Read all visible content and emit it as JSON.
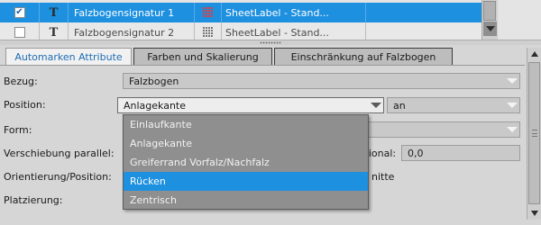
{
  "table": {
    "rows": [
      {
        "checked": true,
        "check_mark": "✔",
        "type_glyph": "T",
        "name": "Falzbogensignatur 1",
        "label": "SheetLabel - Stand..."
      },
      {
        "checked": false,
        "check_mark": "",
        "type_glyph": "T",
        "name": "Falzbogensignatur 2",
        "label": "SheetLabel - Stand..."
      }
    ]
  },
  "tabs": [
    {
      "label": "Automarken Attribute",
      "active": true
    },
    {
      "label": "Farben und Skalierung",
      "active": false
    },
    {
      "label": "Einschränkung auf Falzbogen",
      "active": false
    }
  ],
  "form": {
    "bezug": {
      "label": "Bezug:",
      "value": "Falzbogen"
    },
    "position": {
      "label": "Position:",
      "value": "Anlagekante",
      "secondary_value": "an"
    },
    "form": {
      "label": "Form:"
    },
    "verschiebung": {
      "label": "Verschiebung parallel:",
      "suffix_label": "rtional:",
      "value": "0,0"
    },
    "orientierung": {
      "label": "Orientierung/Position:",
      "suffix_label": "nitte"
    },
    "platzierung": {
      "label": "Platzierung:"
    }
  },
  "dropdown": {
    "options": [
      "Einlaufkante",
      "Anlagekante",
      "Greiferrand Vorfalz/Nachfalz",
      "Rücken",
      "Zentrisch"
    ],
    "highlighted_index": 3
  },
  "colors": {
    "selection": "#1e90e0",
    "active_tab_text": "#1e6db4",
    "accent_red": "#e23c3c"
  }
}
